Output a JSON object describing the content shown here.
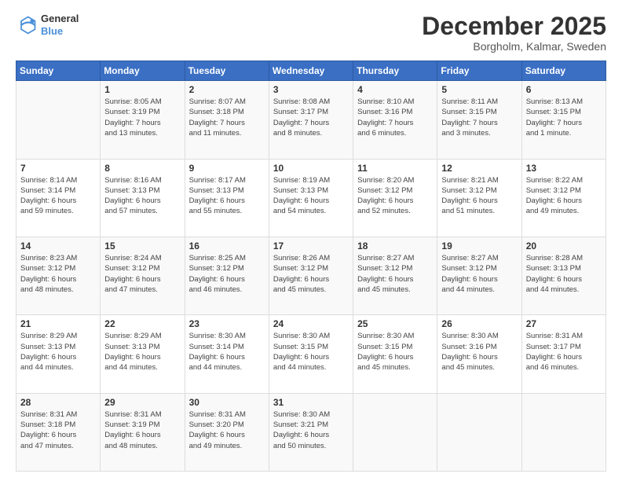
{
  "header": {
    "logo": {
      "line1": "General",
      "line2": "Blue"
    },
    "title": "December 2025",
    "subtitle": "Borgholm, Kalmar, Sweden"
  },
  "days_of_week": [
    "Sunday",
    "Monday",
    "Tuesday",
    "Wednesday",
    "Thursday",
    "Friday",
    "Saturday"
  ],
  "weeks": [
    [
      {
        "day": "",
        "content": ""
      },
      {
        "day": "1",
        "content": "Sunrise: 8:05 AM\nSunset: 3:19 PM\nDaylight: 7 hours\nand 13 minutes."
      },
      {
        "day": "2",
        "content": "Sunrise: 8:07 AM\nSunset: 3:18 PM\nDaylight: 7 hours\nand 11 minutes."
      },
      {
        "day": "3",
        "content": "Sunrise: 8:08 AM\nSunset: 3:17 PM\nDaylight: 7 hours\nand 8 minutes."
      },
      {
        "day": "4",
        "content": "Sunrise: 8:10 AM\nSunset: 3:16 PM\nDaylight: 7 hours\nand 6 minutes."
      },
      {
        "day": "5",
        "content": "Sunrise: 8:11 AM\nSunset: 3:15 PM\nDaylight: 7 hours\nand 3 minutes."
      },
      {
        "day": "6",
        "content": "Sunrise: 8:13 AM\nSunset: 3:15 PM\nDaylight: 7 hours\nand 1 minute."
      }
    ],
    [
      {
        "day": "7",
        "content": "Sunrise: 8:14 AM\nSunset: 3:14 PM\nDaylight: 6 hours\nand 59 minutes."
      },
      {
        "day": "8",
        "content": "Sunrise: 8:16 AM\nSunset: 3:13 PM\nDaylight: 6 hours\nand 57 minutes."
      },
      {
        "day": "9",
        "content": "Sunrise: 8:17 AM\nSunset: 3:13 PM\nDaylight: 6 hours\nand 55 minutes."
      },
      {
        "day": "10",
        "content": "Sunrise: 8:19 AM\nSunset: 3:13 PM\nDaylight: 6 hours\nand 54 minutes."
      },
      {
        "day": "11",
        "content": "Sunrise: 8:20 AM\nSunset: 3:12 PM\nDaylight: 6 hours\nand 52 minutes."
      },
      {
        "day": "12",
        "content": "Sunrise: 8:21 AM\nSunset: 3:12 PM\nDaylight: 6 hours\nand 51 minutes."
      },
      {
        "day": "13",
        "content": "Sunrise: 8:22 AM\nSunset: 3:12 PM\nDaylight: 6 hours\nand 49 minutes."
      }
    ],
    [
      {
        "day": "14",
        "content": "Sunrise: 8:23 AM\nSunset: 3:12 PM\nDaylight: 6 hours\nand 48 minutes."
      },
      {
        "day": "15",
        "content": "Sunrise: 8:24 AM\nSunset: 3:12 PM\nDaylight: 6 hours\nand 47 minutes."
      },
      {
        "day": "16",
        "content": "Sunrise: 8:25 AM\nSunset: 3:12 PM\nDaylight: 6 hours\nand 46 minutes."
      },
      {
        "day": "17",
        "content": "Sunrise: 8:26 AM\nSunset: 3:12 PM\nDaylight: 6 hours\nand 45 minutes."
      },
      {
        "day": "18",
        "content": "Sunrise: 8:27 AM\nSunset: 3:12 PM\nDaylight: 6 hours\nand 45 minutes."
      },
      {
        "day": "19",
        "content": "Sunrise: 8:27 AM\nSunset: 3:12 PM\nDaylight: 6 hours\nand 44 minutes."
      },
      {
        "day": "20",
        "content": "Sunrise: 8:28 AM\nSunset: 3:13 PM\nDaylight: 6 hours\nand 44 minutes."
      }
    ],
    [
      {
        "day": "21",
        "content": "Sunrise: 8:29 AM\nSunset: 3:13 PM\nDaylight: 6 hours\nand 44 minutes."
      },
      {
        "day": "22",
        "content": "Sunrise: 8:29 AM\nSunset: 3:13 PM\nDaylight: 6 hours\nand 44 minutes."
      },
      {
        "day": "23",
        "content": "Sunrise: 8:30 AM\nSunset: 3:14 PM\nDaylight: 6 hours\nand 44 minutes."
      },
      {
        "day": "24",
        "content": "Sunrise: 8:30 AM\nSunset: 3:15 PM\nDaylight: 6 hours\nand 44 minutes."
      },
      {
        "day": "25",
        "content": "Sunrise: 8:30 AM\nSunset: 3:15 PM\nDaylight: 6 hours\nand 45 minutes."
      },
      {
        "day": "26",
        "content": "Sunrise: 8:30 AM\nSunset: 3:16 PM\nDaylight: 6 hours\nand 45 minutes."
      },
      {
        "day": "27",
        "content": "Sunrise: 8:31 AM\nSunset: 3:17 PM\nDaylight: 6 hours\nand 46 minutes."
      }
    ],
    [
      {
        "day": "28",
        "content": "Sunrise: 8:31 AM\nSunset: 3:18 PM\nDaylight: 6 hours\nand 47 minutes."
      },
      {
        "day": "29",
        "content": "Sunrise: 8:31 AM\nSunset: 3:19 PM\nDaylight: 6 hours\nand 48 minutes."
      },
      {
        "day": "30",
        "content": "Sunrise: 8:31 AM\nSunset: 3:20 PM\nDaylight: 6 hours\nand 49 minutes."
      },
      {
        "day": "31",
        "content": "Sunrise: 8:30 AM\nSunset: 3:21 PM\nDaylight: 6 hours\nand 50 minutes."
      },
      {
        "day": "",
        "content": ""
      },
      {
        "day": "",
        "content": ""
      },
      {
        "day": "",
        "content": ""
      }
    ]
  ]
}
